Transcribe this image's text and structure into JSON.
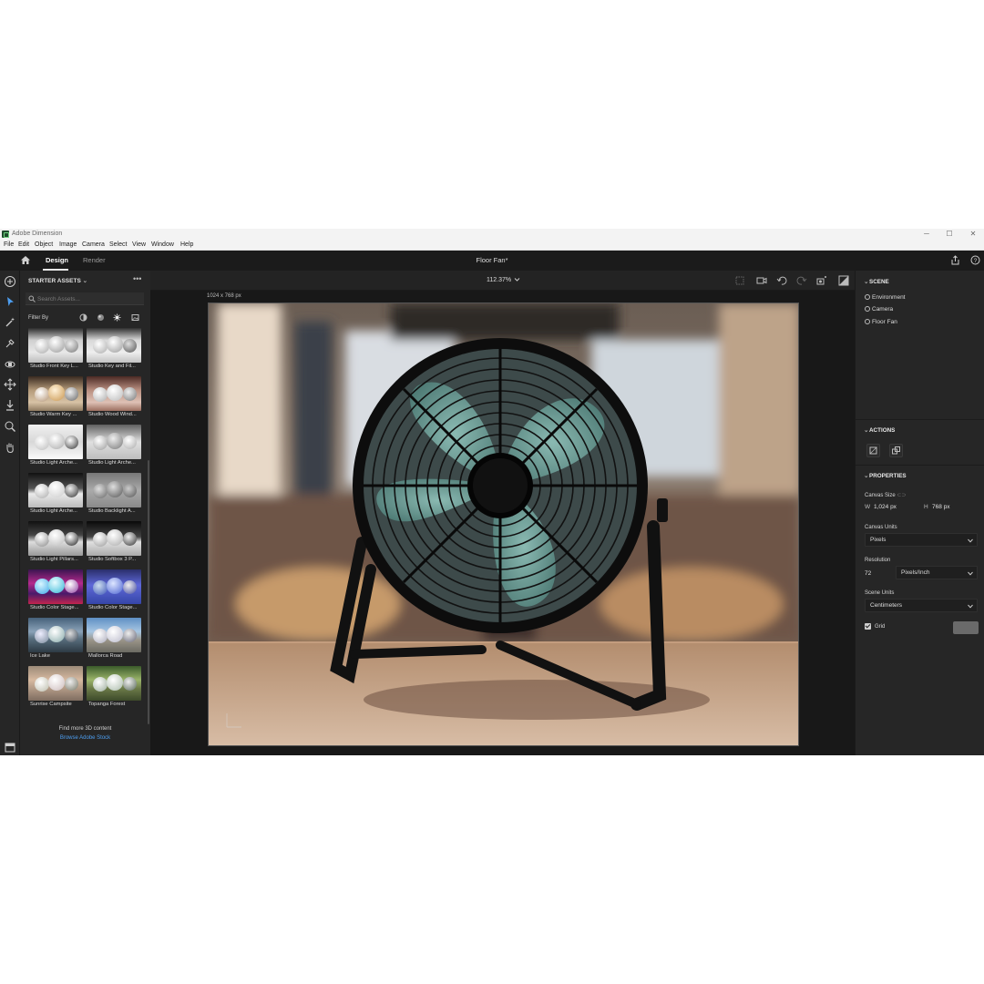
{
  "window": {
    "title": "Adobe Dimension",
    "min": "─",
    "max": "☐",
    "close": "✕"
  },
  "menu": [
    "File",
    "Edit",
    "Object",
    "Image",
    "Camera",
    "Select",
    "View",
    "Window",
    "Help"
  ],
  "header": {
    "tabs": [
      "Design",
      "Render"
    ],
    "active_tab": "Design",
    "doc_title": "Floor Fan*"
  },
  "tools": [
    "select-tool-icon",
    "magic-wand-icon",
    "sample-tool-icon",
    "orbit-camera-icon",
    "pan-camera-icon",
    "dolly-camera-icon",
    "zoom-icon",
    "hand-icon"
  ],
  "assets": {
    "heading": "STARTER ASSETS",
    "more": "•••",
    "search_placeholder": "Search Assets...",
    "filter_label": "Filter By",
    "items": [
      "Studio Front Key L...",
      "Studio Key and Fil...",
      "Studio Warm Key ...",
      "Studio Wood Wind...",
      "Studio Light Arche...",
      "Studio Light Arche...",
      "Studio Light Arche...",
      "Studio Backlight A...",
      "Studio Light Pillars...",
      "Studio Softbox 3 P...",
      "Studio Color Stage...",
      "Studio Color Stage...",
      "Ice Lake",
      "Mallorca Road",
      "Sunrise Campsite",
      "Topanga Forest"
    ],
    "find_more": "Find more 3D content",
    "browse": "Browse Adobe Stock"
  },
  "viewport": {
    "zoom": "112.37%",
    "canvas_dims": "1024 x 768 px"
  },
  "scene": {
    "heading": "SCENE",
    "items": [
      "Environment",
      "Camera",
      "Floor Fan"
    ]
  },
  "actions": {
    "heading": "ACTIONS"
  },
  "properties": {
    "heading": "PROPERTIES",
    "canvas_size_label": "Canvas Size",
    "w_label": "W",
    "w_value": "1,024 px",
    "h_label": "H",
    "h_value": "768 px",
    "canvas_units_label": "Canvas Units",
    "canvas_units_value": "Pixels",
    "resolution_label": "Resolution",
    "resolution_value": "72",
    "resolution_unit": "Pixels/Inch",
    "scene_units_label": "Scene Units",
    "scene_units_value": "Centimeters",
    "grid_label": "Grid"
  },
  "colors": {
    "accent_link": "#4d9ef0",
    "panel": "#262626",
    "viewport": "#181818",
    "fan_blade": "#5f8d88"
  }
}
